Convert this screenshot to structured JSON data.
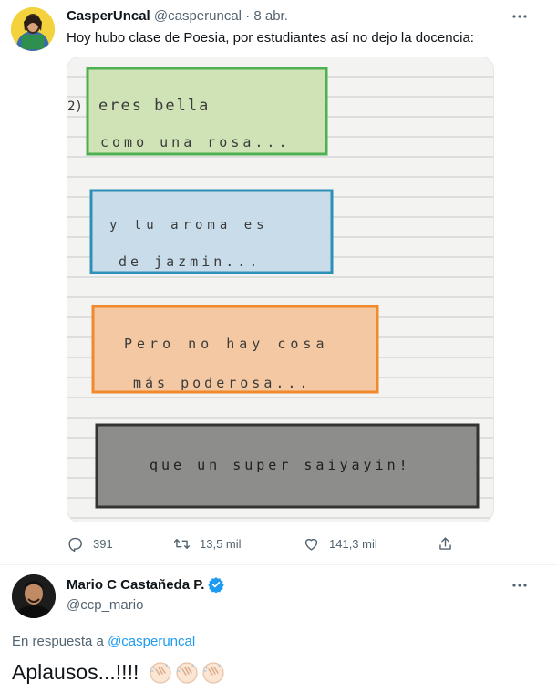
{
  "tweet": {
    "author_name": "CasperUncal",
    "author_handle": "@casperuncal",
    "separator": "·",
    "date": "8 abr.",
    "text": "Hoy hubo clase de Poesia, por estudiantes así no dejo la docencia:",
    "image": {
      "notebook_lines": [
        "eres bella",
        "como una rosa...",
        "y tu aroma es",
        "de jazmin...",
        "Pero no hay cosa",
        "más poderosa...",
        "que un super saiyayin!"
      ],
      "box_colors": [
        "#4caf50",
        "#2e8fb8",
        "#f08a2c",
        "#333333"
      ]
    },
    "actions": {
      "replies": "391",
      "retweets": "13,5 mil",
      "likes": "141,3 mil"
    },
    "icons": [
      "reply-icon",
      "retweet-icon",
      "like-icon",
      "share-icon",
      "more-icon"
    ]
  },
  "reply": {
    "author_name": "Mario C Castañeda P.",
    "author_handle": "@ccp_mario",
    "verified": true,
    "reply_prefix": "En respuesta a",
    "reply_to": "@casperuncal",
    "text": "Aplausos...!!!!",
    "emoji": [
      "clapping-hands",
      "clapping-hands",
      "clapping-hands"
    ]
  },
  "colors": {
    "accent": "#1d9bf0",
    "muted": "#536471",
    "text": "#0f1419"
  }
}
